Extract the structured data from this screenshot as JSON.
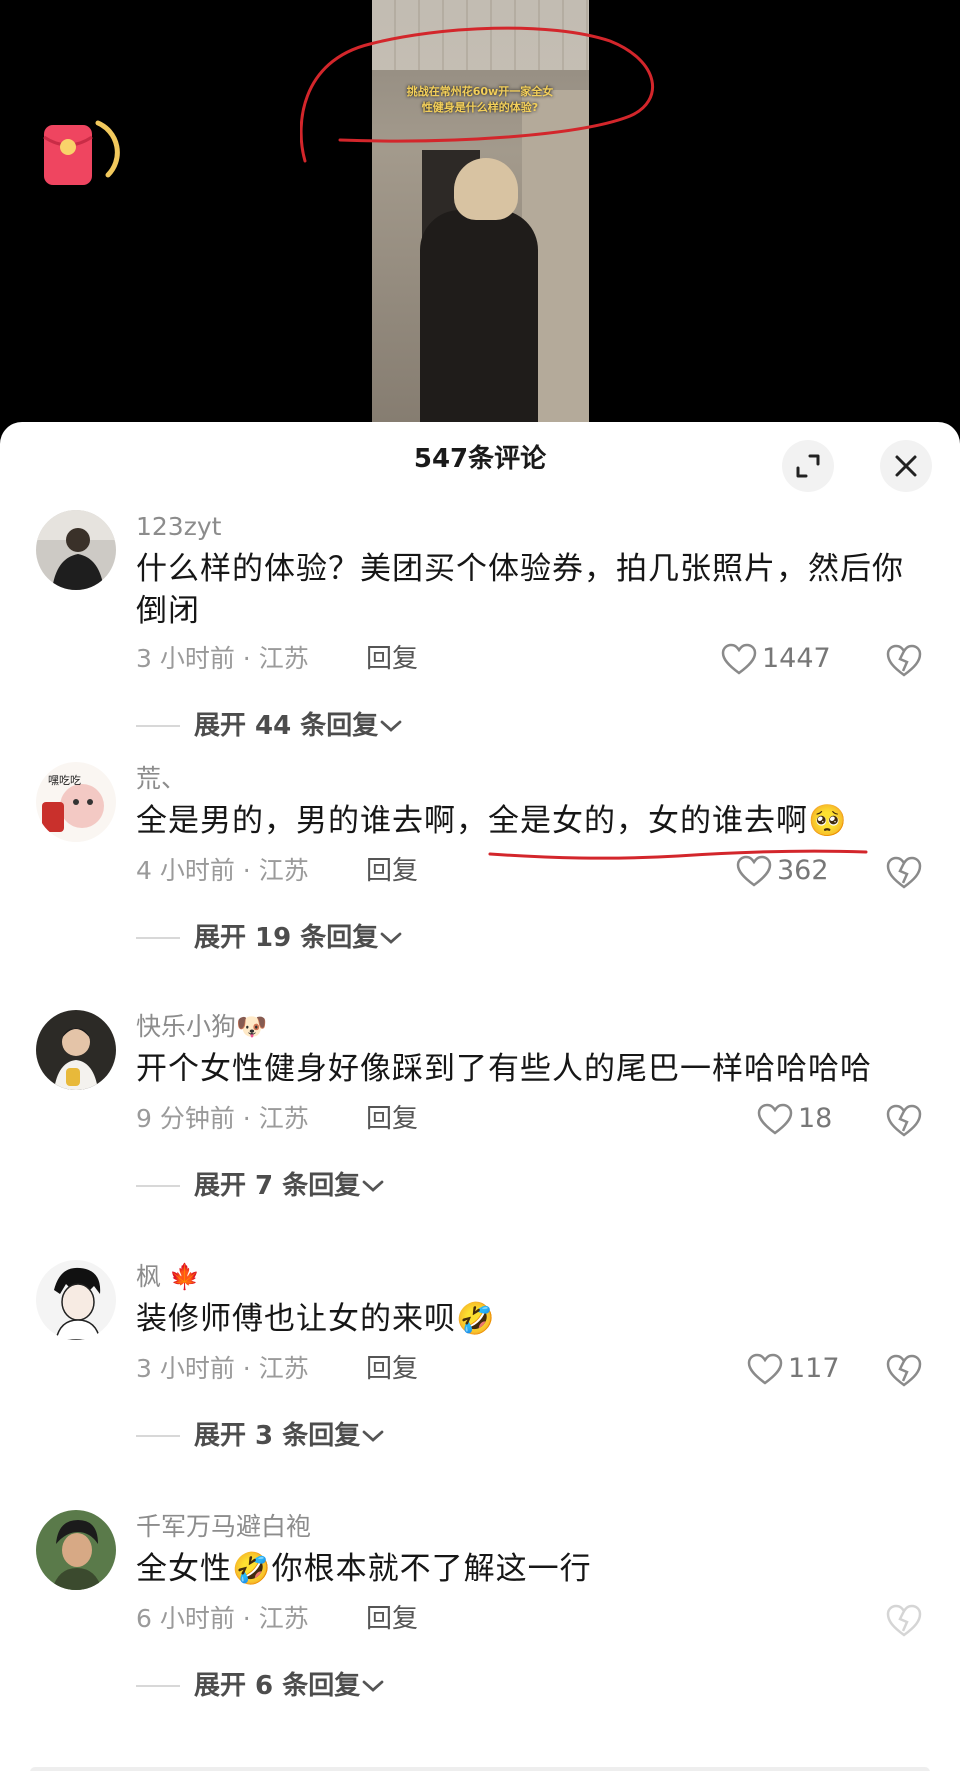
{
  "video": {
    "caption_line1": "挑战在常州花60w开一家全女",
    "caption_line2": "性健身是什么样的体验?",
    "annotation_color": "#d3262b"
  },
  "redpacket": {
    "icon": "red-envelope-icon",
    "color": "#ef4560"
  },
  "sheet": {
    "title": "547条评论",
    "expand_icon": "expand-arrows-icon",
    "close_icon": "close-icon"
  },
  "comments": [
    {
      "user": "123zyt",
      "text": "什么样的体验？美团买个体验券，拍几张照片，然后你倒闭",
      "time": "3 小时前 · 江苏",
      "reply": "回复",
      "likes": "1447",
      "expand": "展开 44 条回复"
    },
    {
      "user": "荒、",
      "text": "全是男的，男的谁去啊，全是女的，女的谁去啊",
      "emoji": "🥺",
      "time": "4 小时前 · 江苏",
      "reply": "回复",
      "likes": "362",
      "expand": "展开 19 条回复"
    },
    {
      "user": "快乐小狗",
      "user_emoji": "🐶",
      "text": "开个女性健身好像踩到了有些人的尾巴一样哈哈哈哈",
      "time": "9 分钟前 · 江苏",
      "reply": "回复",
      "likes": "18",
      "expand": "展开 7 条回复"
    },
    {
      "user": "枫",
      "user_emoji": "🍁",
      "text": "装修师傅也让女的来呗",
      "emoji": "🤣",
      "time": "3 小时前 · 江苏",
      "reply": "回复",
      "likes": "117",
      "expand": "展开 3 条回复"
    },
    {
      "user": "千军万马避白袍",
      "text_a": "全女性",
      "emoji": "🤣",
      "text_b": "你根本就不了解这一行",
      "time": "6 小时前 · 江苏",
      "reply": "回复",
      "expand": "展开 6 条回复"
    }
  ]
}
